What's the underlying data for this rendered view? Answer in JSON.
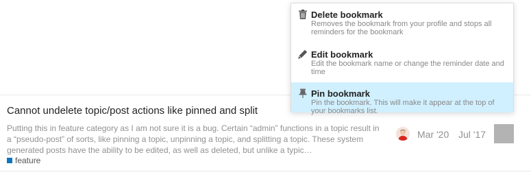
{
  "topic": {
    "title": "Cannot undelete topic/post actions like pinned and split",
    "excerpt": "Putting this in feature category as I am not sure it is a bug. Certain “admin” functions in a topic result in a “pseudo-post” of sorts, like pinning a topic, unpinning a topic, and splitting a topic. These system generated posts have the ability to be edited, as well as deleted, but unlike a typic…",
    "category": {
      "name": "feature",
      "color": "#0e76bd"
    },
    "last_activity": "Mar '20",
    "created": "Jul '17"
  },
  "bookmark_menu": {
    "items": [
      {
        "icon": "trash-icon",
        "title": "Delete bookmark",
        "description": "Removes the bookmark from your profile and stops all reminders for the bookmark"
      },
      {
        "icon": "pencil-icon",
        "title": "Edit bookmark",
        "description": "Edit the bookmark name or change the reminder date and time"
      },
      {
        "icon": "thumbtack-icon",
        "title": "Pin bookmark",
        "description": "Pin the bookmark. This will make it appear at the top of your bookmarks list."
      }
    ],
    "highlight_color": "#d1f0ff"
  }
}
